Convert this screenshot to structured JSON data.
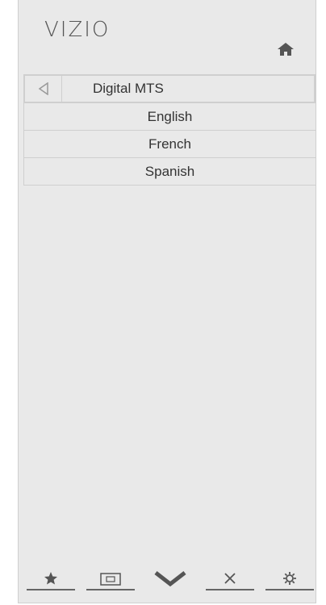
{
  "brand": {
    "logo_text": "VIZIO"
  },
  "header": {
    "home_icon": "home-icon"
  },
  "menu": {
    "title": "Digital MTS",
    "back_icon": "back-arrow-icon",
    "items": [
      {
        "label": "English"
      },
      {
        "label": "French"
      },
      {
        "label": "Spanish"
      }
    ]
  },
  "bottom_bar": {
    "buttons": [
      {
        "name": "favorites",
        "icon": "star-icon"
      },
      {
        "name": "input",
        "icon": "input-icon"
      },
      {
        "name": "wide",
        "icon": "chevron-down-icon"
      },
      {
        "name": "closed-captions",
        "icon": "close-icon"
      },
      {
        "name": "settings",
        "icon": "gear-icon"
      }
    ]
  }
}
